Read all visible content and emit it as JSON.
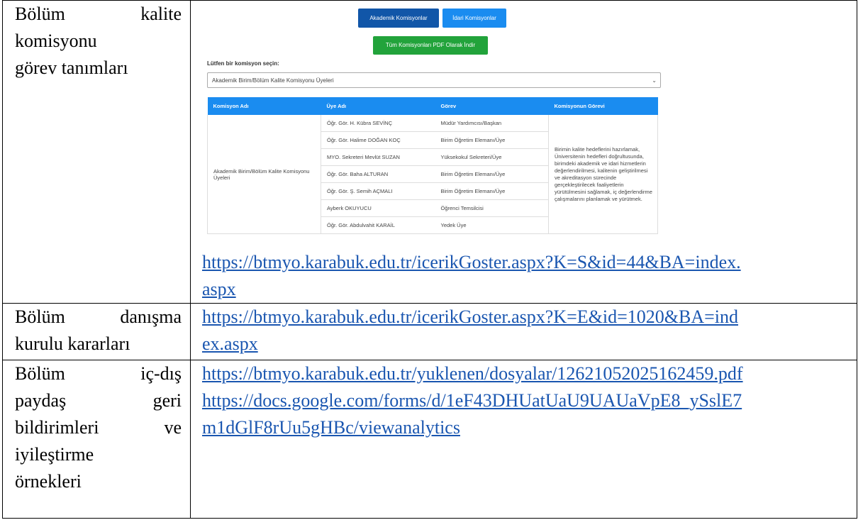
{
  "rows": [
    {
      "label_lines": [
        "Bölüm kalite",
        "komisyonu",
        "görev tanımları"
      ],
      "links": [
        "https://btmyo.karabuk.edu.tr/icerikGoster.aspx?K=S&id=44&BA=index.",
        "aspx"
      ]
    },
    {
      "label_lines": [
        "Bölüm danışma",
        "kurulu kararları"
      ],
      "links": [
        "https://btmyo.karabuk.edu.tr/icerikGoster.aspx?K=E&id=1020&BA=ind",
        "ex.aspx"
      ]
    },
    {
      "label_lines": [
        "Bölüm iç-dış",
        "paydaş geri",
        "bildirimleri ve",
        "iyileştirme",
        "örnekleri"
      ],
      "links": [
        "https://btmyo.karabuk.edu.tr/yuklenen/dosyalar/12621052025162459.pdf",
        "https://docs.google.com/forms/d/1eF43DHUatUaU9UAUaVpE8_ySslE7",
        "m1dGlF8rUu5gHBc/viewanalytics"
      ]
    }
  ],
  "screenshot": {
    "academic_button": "Akademik Komisyonlar",
    "admin_button": "İdari Komisyonlar",
    "pdf_button": "Tüm Komisyonları PDF Olarak İndir",
    "prompt": "Lütfen bir komisyon seçin:",
    "select_value": "Akademik Birim/Bölüm Kalite Komisyonu Üyeleri",
    "columns": [
      "Komisyon Adı",
      "Üye Adı",
      "Görev",
      "Komisyonun Görevi"
    ],
    "commission_name": "Akademik Birim/Bölüm Kalite Komisyonu Üyeleri",
    "members": [
      {
        "name": "Öğr. Gör. H. Kübra SEVİNÇ",
        "role": "Müdür Yardımcısı/Başkan"
      },
      {
        "name": "Öğr. Gör. Halime DOĞAN KOÇ",
        "role": "Birim Öğretim Elemanı/Üye"
      },
      {
        "name": "MYO. Sekreteri Mevlüt SUZAN",
        "role": "Yüksekokul Sekreteri/Üye"
      },
      {
        "name": "Öğr. Gör. Baha ALTURAN",
        "role": "Birim Öğretim Elemanı/Üye"
      },
      {
        "name": "Öğr. Gör. Ş. Semih AÇMALI",
        "role": "Birim Öğretim Elemanı/Üye"
      },
      {
        "name": "Ayberk OKUYUCU",
        "role": "Öğrenci Temsilcisi"
      },
      {
        "name": "Öğr. Gör. Abdulvahit KARAİL",
        "role": "Yedek Üye"
      }
    ],
    "duty_text": "Birimin kalite hedeflerini hazırlamak, Üniversitenin hedefleri doğrultusunda, birimdeki akademik ve idari hizmetlerin değerlendirilmesi, kalitenin geliştirilmesi ve akreditasyon sürecinde gerçekleştirilecek faaliyetlerin yürütülmesini sağlamak, iç değerlendirme çalışmalarını planlamak ve yürütmek."
  }
}
